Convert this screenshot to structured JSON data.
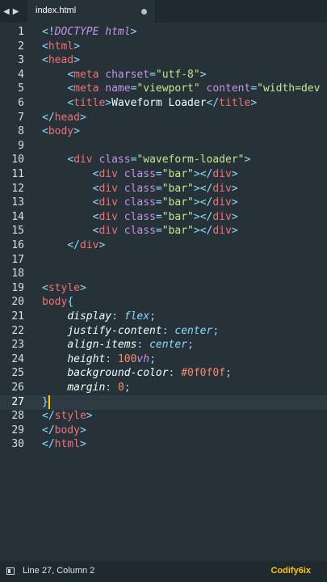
{
  "tab": {
    "label": "index.html"
  },
  "status": {
    "position": "Line 27, Column 2",
    "brand": "Codify6ix"
  },
  "editor": {
    "active_line": 27,
    "lines": [
      {
        "n": "1",
        "t": [
          [
            "punc",
            "<!"
          ],
          [
            "kw",
            "DOCTYPE"
          ],
          [
            "txt",
            " "
          ],
          [
            "kw",
            "html"
          ],
          [
            "punc",
            ">"
          ]
        ]
      },
      {
        "n": "2",
        "t": [
          [
            "punc",
            "<"
          ],
          [
            "tag",
            "html"
          ],
          [
            "punc",
            ">"
          ]
        ]
      },
      {
        "n": "3",
        "t": [
          [
            "punc",
            "<"
          ],
          [
            "tag",
            "head"
          ],
          [
            "punc",
            ">"
          ]
        ]
      },
      {
        "n": "4",
        "t": [
          [
            "txt",
            "    "
          ],
          [
            "punc",
            "<"
          ],
          [
            "tag",
            "meta"
          ],
          [
            "txt",
            " "
          ],
          [
            "attr",
            "charset"
          ],
          [
            "punc",
            "="
          ],
          [
            "str",
            "\"utf-8\""
          ],
          [
            "punc",
            ">"
          ]
        ]
      },
      {
        "n": "5",
        "t": [
          [
            "txt",
            "    "
          ],
          [
            "punc",
            "<"
          ],
          [
            "tag",
            "meta"
          ],
          [
            "txt",
            " "
          ],
          [
            "attr",
            "name"
          ],
          [
            "punc",
            "="
          ],
          [
            "str",
            "\"viewport\""
          ],
          [
            "txt",
            " "
          ],
          [
            "attr",
            "content"
          ],
          [
            "punc",
            "="
          ],
          [
            "str",
            "\"width=dev"
          ]
        ]
      },
      {
        "n": "6",
        "t": [
          [
            "txt",
            "    "
          ],
          [
            "punc",
            "<"
          ],
          [
            "tag",
            "title"
          ],
          [
            "punc",
            ">"
          ],
          [
            "txt",
            "Waveform Loader"
          ],
          [
            "punc",
            "</"
          ],
          [
            "tag",
            "title"
          ],
          [
            "punc",
            ">"
          ]
        ]
      },
      {
        "n": "7",
        "t": [
          [
            "punc",
            "</"
          ],
          [
            "tag",
            "head"
          ],
          [
            "punc",
            ">"
          ]
        ]
      },
      {
        "n": "8",
        "t": [
          [
            "punc",
            "<"
          ],
          [
            "tag",
            "body"
          ],
          [
            "punc",
            ">"
          ]
        ]
      },
      {
        "n": "9",
        "t": []
      },
      {
        "n": "10",
        "t": [
          [
            "txt",
            "    "
          ],
          [
            "punc",
            "<"
          ],
          [
            "tag",
            "div"
          ],
          [
            "txt",
            " "
          ],
          [
            "attr",
            "class"
          ],
          [
            "punc",
            "="
          ],
          [
            "str",
            "\"waveform-loader\""
          ],
          [
            "punc",
            ">"
          ]
        ]
      },
      {
        "n": "11",
        "t": [
          [
            "txt",
            "        "
          ],
          [
            "punc",
            "<"
          ],
          [
            "tag",
            "div"
          ],
          [
            "txt",
            " "
          ],
          [
            "attr",
            "class"
          ],
          [
            "punc",
            "="
          ],
          [
            "str",
            "\"bar\""
          ],
          [
            "punc",
            "></"
          ],
          [
            "tag",
            "div"
          ],
          [
            "punc",
            ">"
          ]
        ]
      },
      {
        "n": "12",
        "t": [
          [
            "txt",
            "        "
          ],
          [
            "punc",
            "<"
          ],
          [
            "tag",
            "div"
          ],
          [
            "txt",
            " "
          ],
          [
            "attr",
            "class"
          ],
          [
            "punc",
            "="
          ],
          [
            "str",
            "\"bar\""
          ],
          [
            "punc",
            "></"
          ],
          [
            "tag",
            "div"
          ],
          [
            "punc",
            ">"
          ]
        ]
      },
      {
        "n": "13",
        "t": [
          [
            "txt",
            "        "
          ],
          [
            "punc",
            "<"
          ],
          [
            "tag",
            "div"
          ],
          [
            "txt",
            " "
          ],
          [
            "attr",
            "class"
          ],
          [
            "punc",
            "="
          ],
          [
            "str",
            "\"bar\""
          ],
          [
            "punc",
            "></"
          ],
          [
            "tag",
            "div"
          ],
          [
            "punc",
            ">"
          ]
        ]
      },
      {
        "n": "14",
        "t": [
          [
            "txt",
            "        "
          ],
          [
            "punc",
            "<"
          ],
          [
            "tag",
            "div"
          ],
          [
            "txt",
            " "
          ],
          [
            "attr",
            "class"
          ],
          [
            "punc",
            "="
          ],
          [
            "str",
            "\"bar\""
          ],
          [
            "punc",
            "></"
          ],
          [
            "tag",
            "div"
          ],
          [
            "punc",
            ">"
          ]
        ]
      },
      {
        "n": "15",
        "t": [
          [
            "txt",
            "        "
          ],
          [
            "punc",
            "<"
          ],
          [
            "tag",
            "div"
          ],
          [
            "txt",
            " "
          ],
          [
            "attr",
            "class"
          ],
          [
            "punc",
            "="
          ],
          [
            "str",
            "\"bar\""
          ],
          [
            "punc",
            "></"
          ],
          [
            "tag",
            "div"
          ],
          [
            "punc",
            ">"
          ]
        ]
      },
      {
        "n": "16",
        "t": [
          [
            "txt",
            "    "
          ],
          [
            "punc",
            "</"
          ],
          [
            "tag",
            "div"
          ],
          [
            "punc",
            ">"
          ]
        ]
      },
      {
        "n": "17",
        "t": []
      },
      {
        "n": "18",
        "t": []
      },
      {
        "n": "19",
        "t": [
          [
            "punc",
            "<"
          ],
          [
            "tag",
            "style"
          ],
          [
            "punc",
            ">"
          ]
        ]
      },
      {
        "n": "20",
        "t": [
          [
            "tag",
            "body"
          ],
          [
            "punc",
            "{"
          ]
        ]
      },
      {
        "n": "21",
        "t": [
          [
            "txt",
            "    "
          ],
          [
            "prop",
            "display"
          ],
          [
            "punc",
            ": "
          ],
          [
            "val",
            "flex"
          ],
          [
            "punc",
            ";"
          ]
        ]
      },
      {
        "n": "22",
        "t": [
          [
            "txt",
            "    "
          ],
          [
            "prop",
            "justify-content"
          ],
          [
            "punc",
            ": "
          ],
          [
            "val",
            "center"
          ],
          [
            "punc",
            ";"
          ]
        ]
      },
      {
        "n": "23",
        "t": [
          [
            "txt",
            "    "
          ],
          [
            "prop",
            "align-items"
          ],
          [
            "punc",
            ": "
          ],
          [
            "val",
            "center"
          ],
          [
            "punc",
            ";"
          ]
        ]
      },
      {
        "n": "24",
        "t": [
          [
            "txt",
            "    "
          ],
          [
            "prop",
            "height"
          ],
          [
            "punc",
            ": "
          ],
          [
            "num",
            "100"
          ],
          [
            "unit",
            "vh"
          ],
          [
            "punc",
            ";"
          ]
        ]
      },
      {
        "n": "25",
        "t": [
          [
            "txt",
            "    "
          ],
          [
            "prop",
            "background-color"
          ],
          [
            "punc",
            ": "
          ],
          [
            "num",
            "#0f0f0f"
          ],
          [
            "punc",
            ";"
          ]
        ]
      },
      {
        "n": "26",
        "t": [
          [
            "txt",
            "    "
          ],
          [
            "prop",
            "margin"
          ],
          [
            "punc",
            ": "
          ],
          [
            "num",
            "0"
          ],
          [
            "punc",
            ";"
          ]
        ]
      },
      {
        "n": "27",
        "t": [
          [
            "punc",
            "}"
          ]
        ]
      },
      {
        "n": "28",
        "t": [
          [
            "punc",
            "</"
          ],
          [
            "tag",
            "style"
          ],
          [
            "punc",
            ">"
          ]
        ]
      },
      {
        "n": "29",
        "t": [
          [
            "punc",
            "</"
          ],
          [
            "tag",
            "body"
          ],
          [
            "punc",
            ">"
          ]
        ]
      },
      {
        "n": "30",
        "t": [
          [
            "punc",
            "</"
          ],
          [
            "tag",
            "html"
          ],
          [
            "punc",
            ">"
          ]
        ]
      }
    ]
  }
}
